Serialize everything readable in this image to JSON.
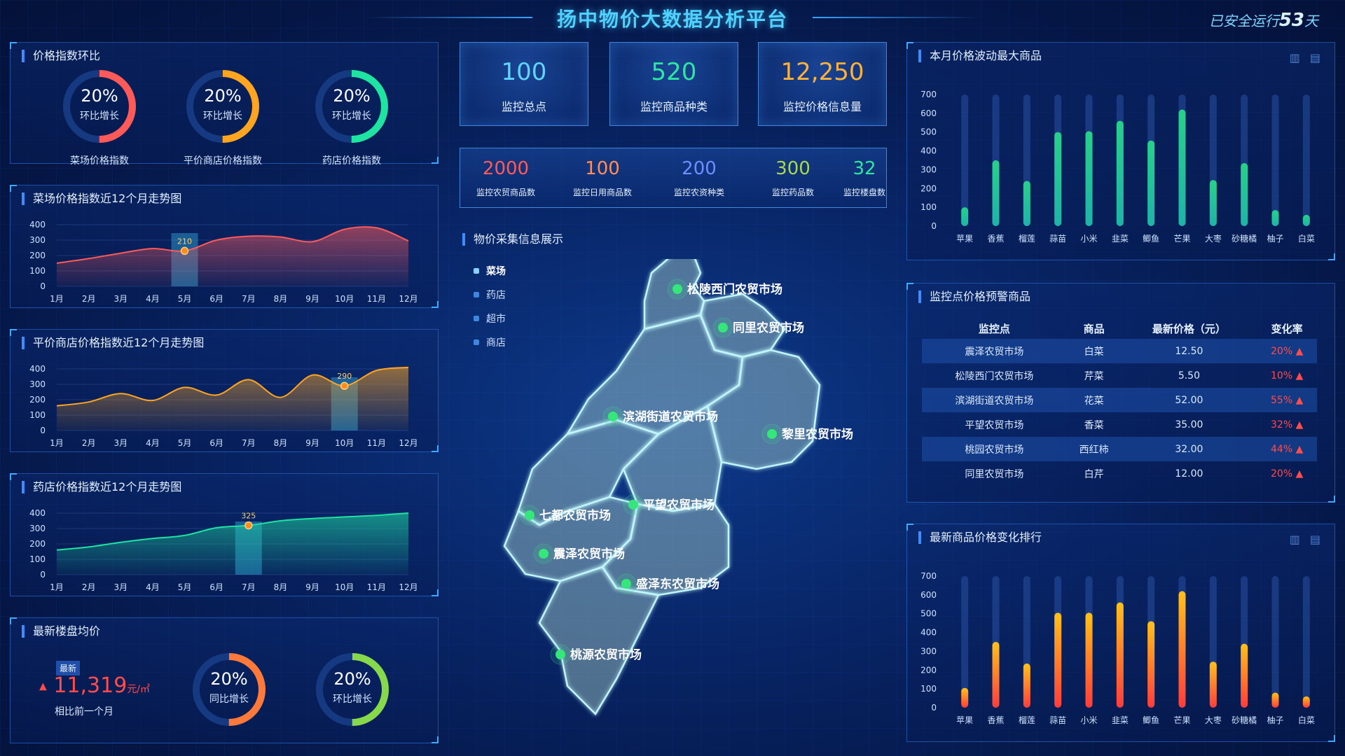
{
  "header": {
    "title": "扬中物价大数据分析平台",
    "runtime_prefix": "已安全运行",
    "runtime_days": "53",
    "runtime_suffix": "天"
  },
  "panels": {
    "price_index": "价格指数环比",
    "market_trend": "菜场价格指数近12个月走势图",
    "store_trend": "平价商店价格指数近12个月走势图",
    "pharmacy_trend": "药店价格指数近12个月走势图",
    "housing": "最新楼盘均价",
    "monthly_volatility": "本月价格波动最大商品",
    "alert_table": "监控点价格预警商品",
    "latest_ranking": "最新商品价格变化排行",
    "map_title": "物价采集信息展示"
  },
  "gauges": [
    {
      "value": "20%",
      "sub": "环比增长",
      "caption": "菜场价格指数",
      "percent": 0.2,
      "color": "#ff5a5a"
    },
    {
      "value": "20%",
      "sub": "环比增长",
      "caption": "平价商店价格指数",
      "percent": 0.2,
      "color": "#ffa51f"
    },
    {
      "value": "20%",
      "sub": "环比增长",
      "caption": "药店价格指数",
      "percent": 0.2,
      "color": "#1fe3a0"
    }
  ],
  "housing": {
    "badge": "最新",
    "arrow": "▲",
    "price": "11,319",
    "unit": "元/㎡",
    "note": "相比前一个月",
    "gauges": [
      {
        "value": "20%",
        "sub": "同比增长",
        "percent": 0.2,
        "color": "#ff7a3a"
      },
      {
        "value": "20%",
        "sub": "环比增长",
        "percent": 0.2,
        "color": "#86d94b"
      }
    ]
  },
  "stats": [
    {
      "num": "100",
      "label": "监控总点",
      "color": "#5fd4ff"
    },
    {
      "num": "520",
      "label": "监控商品种类",
      "color": "#2fe6a0"
    },
    {
      "num": "12,250",
      "label": "监控价格信息量",
      "color": "#ffb23a"
    }
  ],
  "strip": [
    {
      "num": "2000",
      "label": "监控农贸商品数",
      "color": "#ff5a5a"
    },
    {
      "num": "100",
      "label": "监控日用商品数",
      "color": "#ff8f5a"
    },
    {
      "num": "200",
      "label": "监控农资种类",
      "color": "#6f8dff"
    },
    {
      "num": "300",
      "label": "监控药品数",
      "color": "#a8d84e"
    },
    {
      "num": "32",
      "label": "监控楼盘数",
      "color": "#2fe6a0"
    }
  ],
  "map_legend": [
    "菜场",
    "药店",
    "超市",
    "商店"
  ],
  "map_markets": [
    "松陵西门农贸市场",
    "同里农贸市场",
    "滨湖街道农贸市场",
    "黎里农贸市场",
    "平望农贸市场",
    "七都农贸市场",
    "震泽农贸市场",
    "盛泽东农贸市场",
    "桃源农贸市场"
  ],
  "alert_table": {
    "columns": [
      "监控点",
      "商品",
      "最新价格（元）",
      "变化率"
    ],
    "rows": [
      [
        "震泽农贸市场",
        "白菜",
        "12.50",
        "20% ▲"
      ],
      [
        "松陵西门农贸市场",
        "芹菜",
        "5.50",
        "10% ▲"
      ],
      [
        "滨湖街道农贸市场",
        "花菜",
        "52.00",
        "55% ▲"
      ],
      [
        "平望农贸市场",
        "香菜",
        "35.00",
        "32% ▲"
      ],
      [
        "桃园农贸市场",
        "西红柿",
        "32.00",
        "44% ▲"
      ],
      [
        "同里农贸市场",
        "白芹",
        "12.00",
        "20% ▲"
      ]
    ]
  },
  "chart_data": [
    {
      "type": "area",
      "title": "菜场价格指数近12个月走势图",
      "x": [
        "1月",
        "2月",
        "3月",
        "4月",
        "5月",
        "6月",
        "7月",
        "8月",
        "9月",
        "10月",
        "11月",
        "12月"
      ],
      "y": [
        150,
        180,
        215,
        245,
        230,
        300,
        325,
        320,
        290,
        370,
        380,
        295
      ],
      "ylim": [
        0,
        400
      ],
      "yticks": [
        0,
        100,
        200,
        300,
        400
      ],
      "highlight": {
        "index": 4,
        "label": "210"
      },
      "color": "#ff5a5a"
    },
    {
      "type": "area",
      "title": "平价商店价格指数近12个月走势图",
      "x": [
        "1月",
        "2月",
        "3月",
        "4月",
        "5月",
        "6月",
        "7月",
        "8月",
        "9月",
        "10月",
        "11月",
        "12月"
      ],
      "y": [
        160,
        185,
        240,
        195,
        280,
        230,
        330,
        215,
        360,
        290,
        390,
        410
      ],
      "ylim": [
        0,
        400
      ],
      "yticks": [
        0,
        100,
        200,
        300,
        400
      ],
      "highlight": {
        "index": 9,
        "label": "290"
      },
      "color": "#ffa51f"
    },
    {
      "type": "area",
      "title": "药店价格指数近12个月走势图",
      "x": [
        "1月",
        "2月",
        "3月",
        "4月",
        "5月",
        "6月",
        "7月",
        "8月",
        "9月",
        "10月",
        "11月",
        "12月"
      ],
      "y": [
        160,
        180,
        210,
        235,
        255,
        305,
        320,
        350,
        365,
        375,
        385,
        400
      ],
      "ylim": [
        0,
        400
      ],
      "yticks": [
        0,
        100,
        200,
        300,
        400
      ],
      "highlight": {
        "index": 6,
        "label": "325"
      },
      "color": "#1fe3a0"
    },
    {
      "type": "bar",
      "title": "本月价格波动最大商品",
      "categories": [
        "苹果",
        "香蕉",
        "榴莲",
        "蒜苗",
        "小米",
        "韭菜",
        "鲫鱼",
        "芒果",
        "大枣",
        "砂糖橘",
        "柚子",
        "白菜"
      ],
      "values": [
        100,
        350,
        240,
        500,
        505,
        560,
        455,
        620,
        245,
        335,
        85,
        60
      ],
      "ylim": [
        0,
        700
      ],
      "yticks": [
        0,
        100,
        200,
        300,
        400,
        500,
        600,
        700
      ],
      "colors": [
        "#1fb3a8",
        "#28d08a"
      ]
    },
    {
      "type": "bar",
      "title": "最新商品价格变化排行",
      "categories": [
        "苹果",
        "香蕉",
        "榴莲",
        "蒜苗",
        "小米",
        "韭菜",
        "鲫鱼",
        "芒果",
        "大枣",
        "砂糖橘",
        "柚子",
        "白菜"
      ],
      "values": [
        105,
        350,
        235,
        505,
        505,
        560,
        460,
        620,
        245,
        340,
        80,
        60
      ],
      "ylim": [
        0,
        700
      ],
      "yticks": [
        0,
        100,
        200,
        300,
        400,
        500,
        600,
        700
      ],
      "colors": [
        "#ff3c3c",
        "#ffc21a"
      ]
    }
  ]
}
